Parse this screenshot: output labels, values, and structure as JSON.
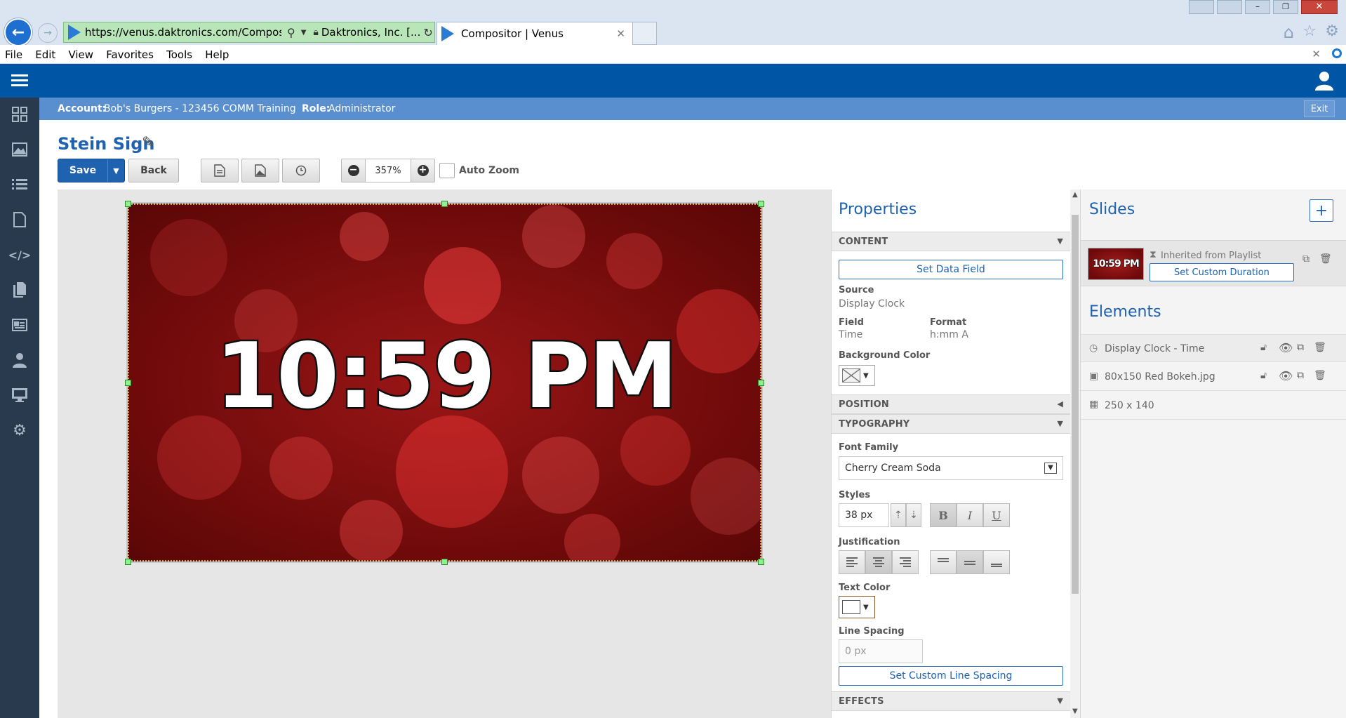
{
  "browser": {
    "url": "https://venus.daktronics.com/Compositc",
    "site_identity": "Daktronics, Inc. [...",
    "tab_title": "Compositor | Venus",
    "menu": [
      "File",
      "Edit",
      "View",
      "Favorites",
      "Tools",
      "Help"
    ]
  },
  "account_bar": {
    "account_label": "Account:",
    "account_value": "Bob's Burgers - 123456 COMM Training",
    "role_label": "Role:",
    "role_value": "Administrator",
    "exit_label": "Exit"
  },
  "page": {
    "title": "Stein Sign"
  },
  "toolbar": {
    "save_label": "Save",
    "back_label": "Back",
    "zoom_value": "357%",
    "auto_zoom_label": "Auto Zoom"
  },
  "canvas": {
    "clock_text": "10:59 PM"
  },
  "properties": {
    "title": "Properties",
    "content_header": "CONTENT",
    "set_data_field_label": "Set Data Field",
    "source_label": "Source",
    "source_value": "Display Clock",
    "field_label": "Field",
    "field_value": "Time",
    "format_label": "Format",
    "format_value": "h:mm A",
    "bg_color_label": "Background Color",
    "position_header": "POSITION",
    "typography_header": "TYPOGRAPHY",
    "font_family_label": "Font Family",
    "font_family_value": "Cherry Cream Soda",
    "styles_label": "Styles",
    "font_size_value": "38 px",
    "bold_label": "B",
    "italic_label": "I",
    "underline_label": "U",
    "justification_label": "Justification",
    "text_color_label": "Text Color",
    "line_spacing_label": "Line Spacing",
    "line_spacing_placeholder": "0 px",
    "set_custom_line_spacing_label": "Set Custom Line Spacing",
    "effects_header": "EFFECTS"
  },
  "slides": {
    "title": "Slides",
    "add_label": "+",
    "thumb_text": "10:59 PM",
    "duration_text": "Inherited from Playlist",
    "set_custom_duration_label": "Set Custom Duration"
  },
  "elements": {
    "title": "Elements",
    "items": [
      {
        "label": "Display Clock - Time"
      },
      {
        "label": "80x150 Red Bokeh.jpg"
      },
      {
        "label": "250 x 140"
      }
    ]
  },
  "colors": {
    "app_header": "#0055a4",
    "account_bar": "#5a8fcf",
    "left_nav": "#2a3a4e",
    "accent_blue": "#1e62b0",
    "canvas_bg_dark_red": "#6e0a0a"
  }
}
